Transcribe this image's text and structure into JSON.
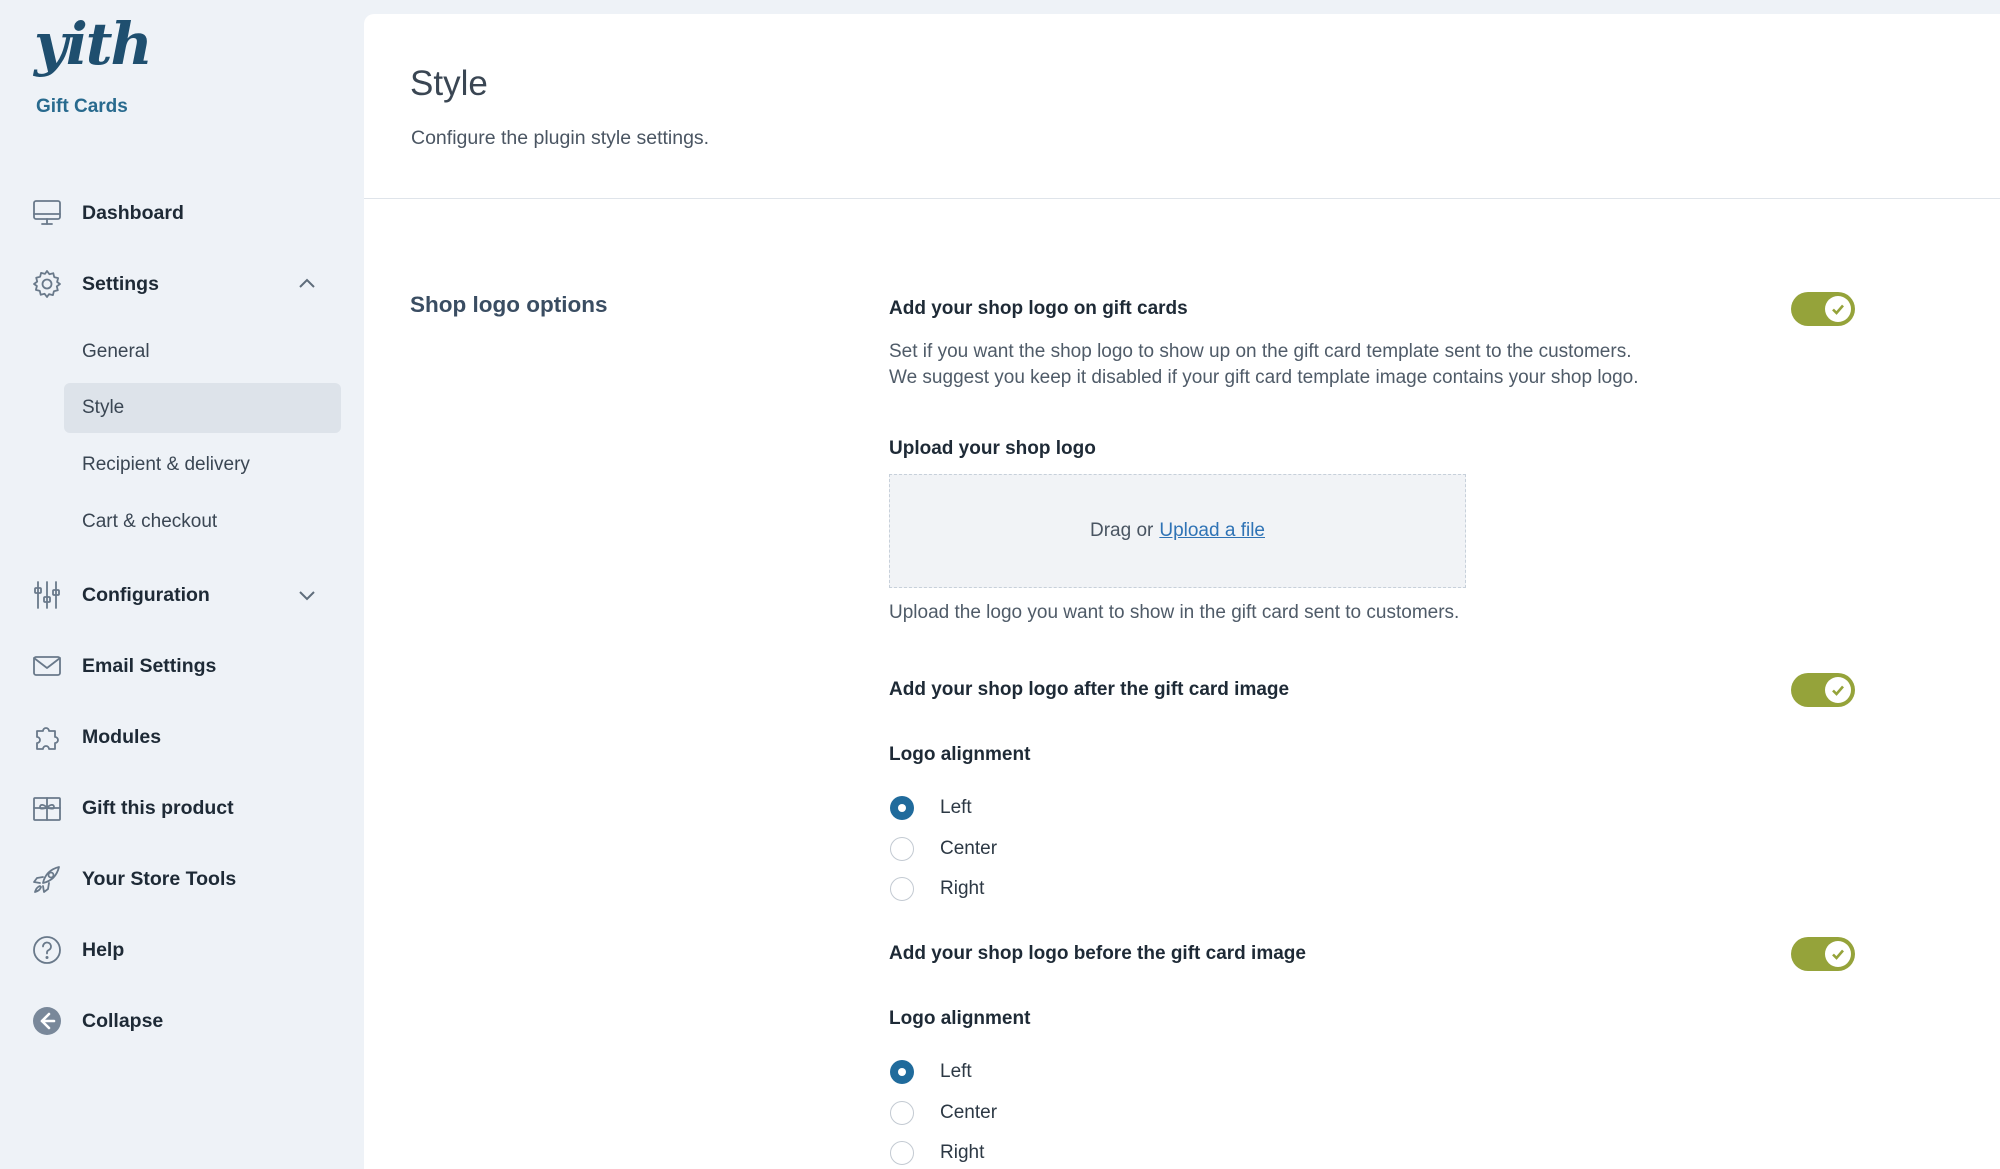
{
  "brand": {
    "logo_text": "yith",
    "product_name": "Gift Cards"
  },
  "sidebar": {
    "items": [
      {
        "label": "Dashboard",
        "icon": "monitor-icon"
      },
      {
        "label": "Settings",
        "icon": "gear-icon",
        "expanded": true
      },
      {
        "label": "Configuration",
        "icon": "sliders-icon",
        "expanded": false
      },
      {
        "label": "Email Settings",
        "icon": "envelope-icon"
      },
      {
        "label": "Modules",
        "icon": "puzzle-icon"
      },
      {
        "label": "Gift this product",
        "icon": "gift-icon"
      },
      {
        "label": "Your Store Tools",
        "icon": "rocket-icon"
      },
      {
        "label": "Help",
        "icon": "help-icon"
      },
      {
        "label": "Collapse",
        "icon": "collapse-arrow-icon"
      }
    ],
    "settings_subitems": [
      {
        "label": "General"
      },
      {
        "label": "Style",
        "active": true
      },
      {
        "label": "Recipient & delivery"
      },
      {
        "label": "Cart & checkout"
      }
    ]
  },
  "page": {
    "title": "Style",
    "description": "Configure the plugin style settings."
  },
  "section": {
    "title": "Shop logo options",
    "opt1": {
      "label": "Add your shop logo on gift cards",
      "desc_line1": "Set if you want the shop logo to show up on the gift card template sent to the customers.",
      "desc_line2": "We suggest you keep it disabled if your gift card template image contains your shop logo.",
      "enabled": true
    },
    "upload": {
      "label": "Upload your shop logo",
      "drag_text": "Drag or",
      "link_text": "Upload a file",
      "help": "Upload the logo you want to show in the gift card sent to customers."
    },
    "opt2": {
      "label": "Add your shop logo after the gift card image",
      "enabled": true,
      "alignment_label": "Logo alignment",
      "options": [
        "Left",
        "Center",
        "Right"
      ],
      "selected": "Left"
    },
    "opt3": {
      "label": "Add your shop logo before the gift card image",
      "enabled": true,
      "alignment_label": "Logo alignment",
      "options": [
        "Left",
        "Center",
        "Right"
      ],
      "selected": "Left"
    }
  },
  "colors": {
    "accent_green": "#95a33a",
    "radio_blue": "#206b9c",
    "link_blue": "#2f73b5",
    "brand_blue": "#286a8e"
  }
}
